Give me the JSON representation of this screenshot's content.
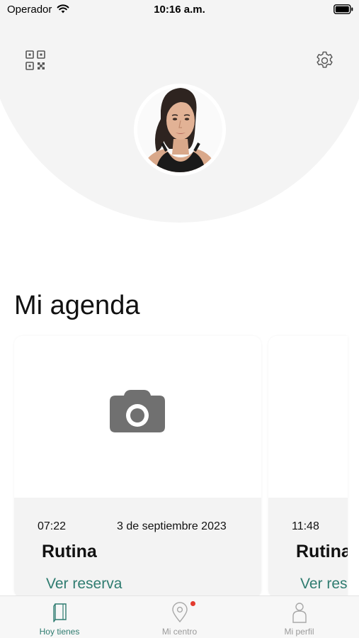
{
  "status_bar": {
    "carrier": "Operador",
    "time": "10:16 a.m.",
    "wifi_icon": "wifi-icon",
    "battery_icon": "battery-icon"
  },
  "header": {
    "qr_icon": "qr-code-icon",
    "settings_icon": "gear-icon",
    "avatar": "profile-photo"
  },
  "agenda": {
    "title": "Mi agenda",
    "cards": [
      {
        "image_icon": "camera-icon",
        "time": "07:22",
        "date": "3 de septiembre 2023",
        "title": "Rutina",
        "link": "Ver reserva"
      },
      {
        "time": "11:48",
        "title": "Rutina",
        "link": "Ver reserva"
      }
    ]
  },
  "tab_bar": {
    "tabs": [
      {
        "label": "Hoy tienes",
        "icon": "book-icon",
        "active": true
      },
      {
        "label": "Mi centro",
        "icon": "location-pin-icon",
        "badge": true
      },
      {
        "label": "Mi perfil",
        "icon": "person-icon"
      }
    ]
  },
  "colors": {
    "accent": "#2f7c70",
    "header_background": "#f4f4f4",
    "card_info_background": "#f3f3f3",
    "notification": "#e33b2f"
  }
}
